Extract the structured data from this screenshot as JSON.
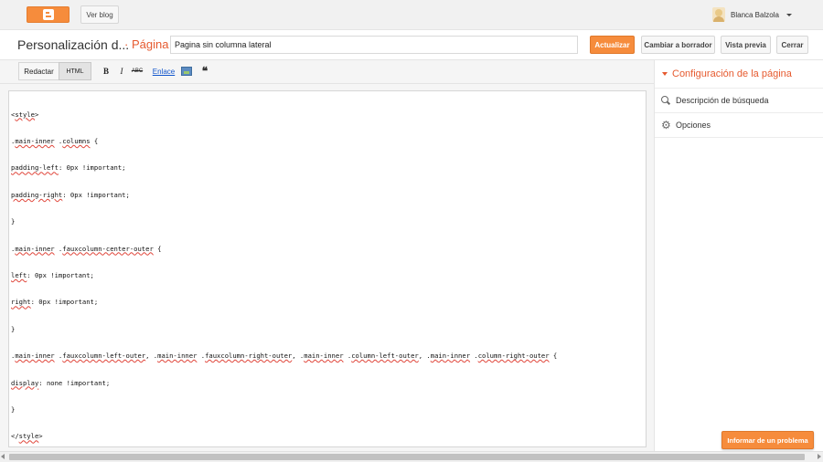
{
  "topbar": {
    "logo_icon": "blogger-logo-icon",
    "view_blog": "Ver blog",
    "user_name": "Blanca Balzola",
    "caret_icon": "caret-down-icon"
  },
  "header": {
    "title": "Personalización d...",
    "section": "· Página",
    "page_title_value": "Pagina sin columna lateral",
    "update": "Actualizar",
    "draft": "Cambiar a borrador",
    "preview": "Vista previa",
    "close": "Cerrar"
  },
  "toolbar": {
    "compose": "Redactar",
    "html": "HTML",
    "bold": "B",
    "italic": "I",
    "strike": "ABC",
    "link": "Enlace",
    "image_icon": "image-icon",
    "quote": "❝"
  },
  "editor": {
    "lines": [
      "<style>",
      ".main-inner .columns {",
      "padding-left: 0px !important;",
      "padding-right: 0px !important;",
      "}",
      ".main-inner .fauxcolumn-center-outer {",
      "left: 0px !important;",
      "right: 0px !important;",
      "}",
      ".main-inner .fauxcolumn-left-outer, .main-inner .fauxcolumn-right-outer, .main-inner .column-left-outer, .main-inner .column-right-outer {",
      "display: none !important;",
      "}",
      "</style>"
    ]
  },
  "sidebar": {
    "heading": "Configuración de la página",
    "items": [
      {
        "label": "Descripción de búsqueda",
        "icon": "search-icon"
      },
      {
        "label": "Opciones",
        "icon": "gear-icon"
      }
    ]
  },
  "footer": {
    "report": "Informar de un problema"
  },
  "colors": {
    "accent": "#f68c3c",
    "accent_text": "#e65a2f",
    "link": "#1155cc"
  }
}
